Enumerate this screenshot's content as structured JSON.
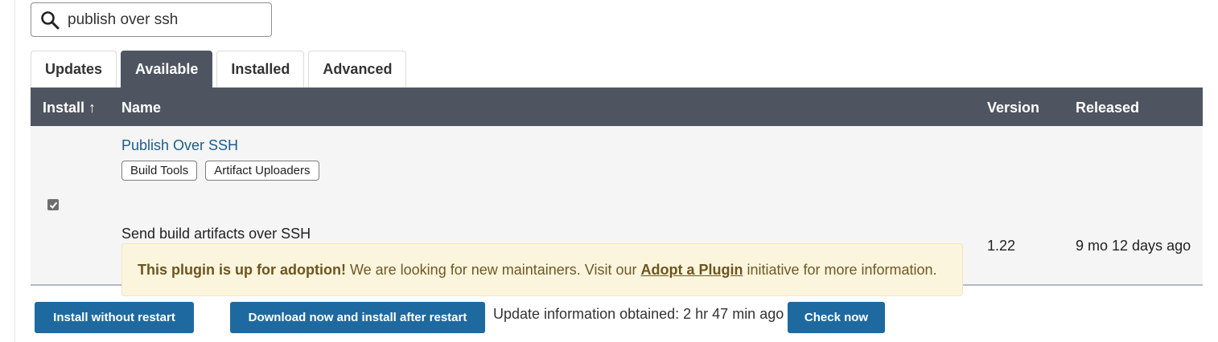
{
  "search": {
    "value": "publish over ssh",
    "icon": "search-icon"
  },
  "tabs": [
    {
      "label": "Updates"
    },
    {
      "label": "Available",
      "active": true
    },
    {
      "label": "Installed"
    },
    {
      "label": "Advanced"
    }
  ],
  "table": {
    "headers": {
      "install": "Install ↑",
      "name": "Name",
      "version": "Version",
      "released": "Released"
    },
    "rows": [
      {
        "checked": true,
        "name": "Publish Over SSH",
        "tags": [
          "Build Tools",
          "Artifact Uploaders"
        ],
        "description": "Send build artifacts over SSH",
        "notice": {
          "bold": "This plugin is up for adoption!",
          "before_link": "We are looking for new maintainers. Visit our",
          "link": "Adopt a Plugin",
          "after_link": "initiative for more information."
        },
        "version": "1.22",
        "released": "9 mo 12 days ago"
      }
    ]
  },
  "footer": {
    "install_without_restart": "Install without restart",
    "download_install_after_restart": "Download now and install after restart",
    "update_info": "Update information obtained: 2 hr 47 min ago",
    "check_now": "Check now"
  },
  "colors": {
    "header_bg": "#4f5560",
    "button_bg": "#1e6aa0",
    "link": "#1a5d8e",
    "notice_bg": "#fcf5dd"
  }
}
